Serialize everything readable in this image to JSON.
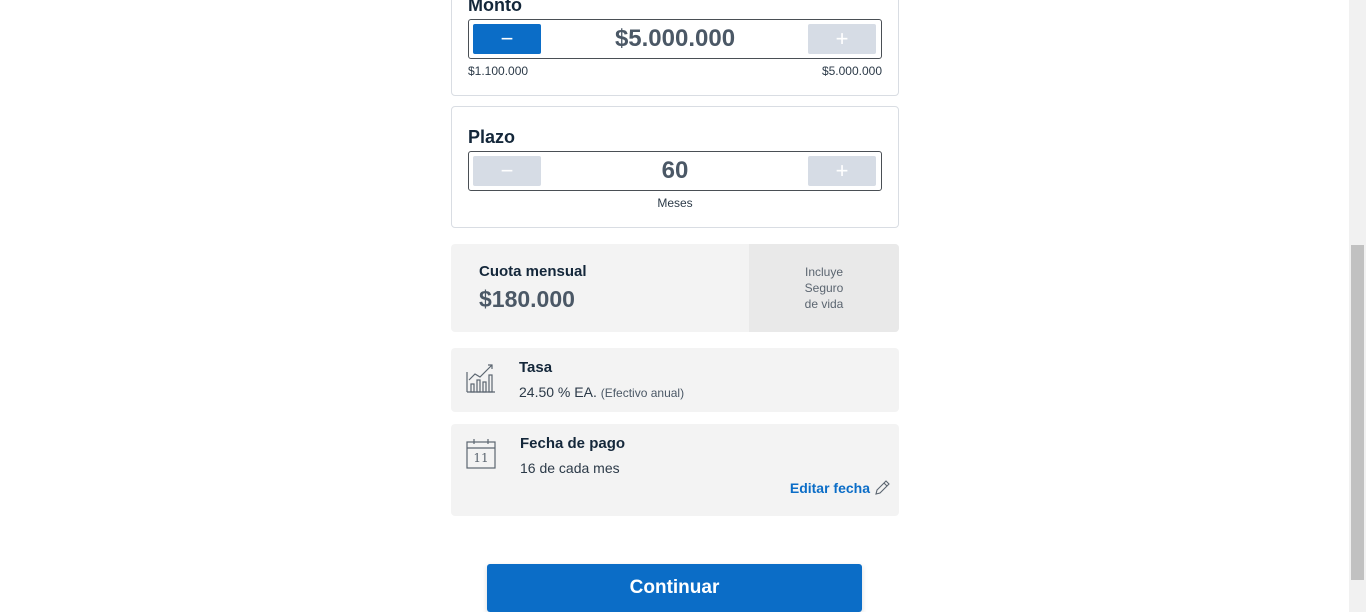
{
  "monto": {
    "label": "Monto",
    "value": "$5.000.000",
    "min": "$1.100.000",
    "max": "$5.000.000",
    "minus": "−",
    "plus": "+"
  },
  "plazo": {
    "label": "Plazo",
    "value": "60",
    "unit": "Meses",
    "minus": "−",
    "plus": "+"
  },
  "cuota": {
    "label": "Cuota mensual",
    "value": "$180.000",
    "note_line1": "Incluye",
    "note_line2": "Seguro",
    "note_line3": "de vida"
  },
  "tasa": {
    "label": "Tasa",
    "value": "24.50 % EA.",
    "detail": "(Efectivo anual)",
    "icon": "chart-growth-icon"
  },
  "fecha": {
    "label": "Fecha de pago",
    "value": "16 de cada mes",
    "edit_label": "Editar fecha",
    "calendar_day": "11",
    "icon": "calendar-icon"
  },
  "actions": {
    "continue_label": "Continuar"
  },
  "colors": {
    "primary": "#0b6dc7",
    "disabled": "#d6dce5",
    "panel": "#f3f3f3"
  }
}
